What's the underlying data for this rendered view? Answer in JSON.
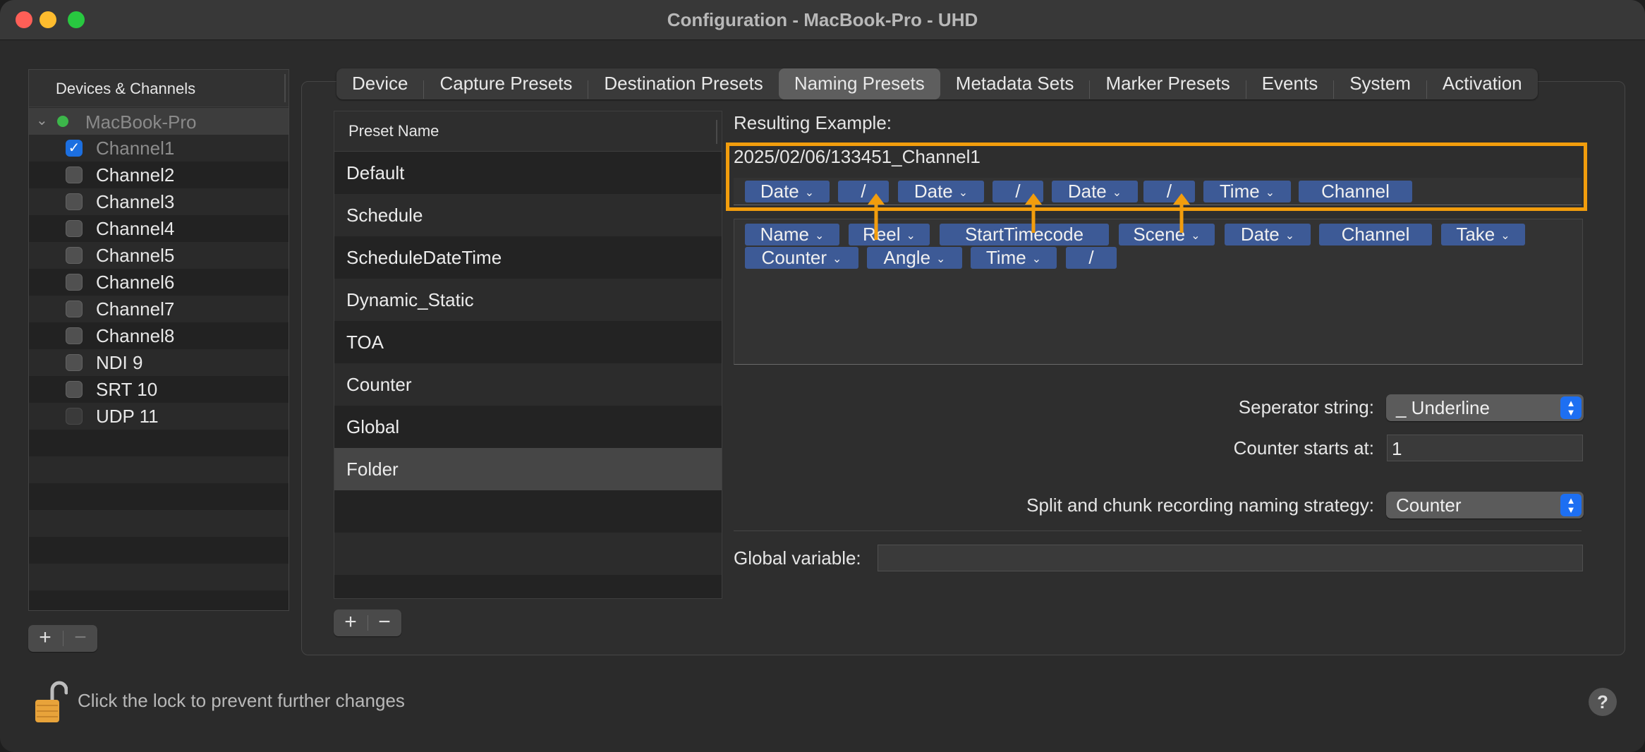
{
  "window": {
    "title": "Configuration - MacBook-Pro - UHD"
  },
  "devices": {
    "header": "Devices & Channels",
    "device": {
      "name": "MacBook-Pro",
      "status_color": "#3cb64a"
    },
    "channels": [
      {
        "label": "Channel1",
        "checked": true
      },
      {
        "label": "Channel2",
        "checked": false
      },
      {
        "label": "Channel3",
        "checked": false
      },
      {
        "label": "Channel4",
        "checked": false
      },
      {
        "label": "Channel5",
        "checked": false
      },
      {
        "label": "Channel6",
        "checked": false
      },
      {
        "label": "Channel7",
        "checked": false
      },
      {
        "label": "Channel8",
        "checked": false
      },
      {
        "label": "NDI 9",
        "checked": false
      },
      {
        "label": "SRT 10",
        "checked": false
      },
      {
        "label": "UDP 11",
        "checked": false
      }
    ],
    "add_label": "+",
    "remove_label": "−"
  },
  "tabs": [
    {
      "label": "Device",
      "active": false
    },
    {
      "label": "Capture Presets",
      "active": false
    },
    {
      "label": "Destination Presets",
      "active": false
    },
    {
      "label": "Naming Presets",
      "active": true
    },
    {
      "label": "Metadata Sets",
      "active": false
    },
    {
      "label": "Marker Presets",
      "active": false
    },
    {
      "label": "Events",
      "active": false
    },
    {
      "label": "System",
      "active": false
    },
    {
      "label": "Activation",
      "active": false
    }
  ],
  "presets": {
    "column_header": "Preset Name",
    "items": [
      "Default",
      "Schedule",
      "ScheduleDateTime",
      "Dynamic_Static",
      "TOA",
      "Counter",
      "Global",
      "Folder"
    ],
    "selected": "Folder",
    "add_label": "+",
    "remove_label": "−"
  },
  "naming": {
    "resulting_example_label": "Resulting Example:",
    "resulting_example_value": "2025/02/06/133451_Channel1",
    "pattern_tokens": [
      {
        "label": "Date",
        "dropdown": true
      },
      {
        "label": "/",
        "dropdown": false
      },
      {
        "label": "Date",
        "dropdown": true
      },
      {
        "label": "/",
        "dropdown": false
      },
      {
        "label": "Date",
        "dropdown": true
      },
      {
        "label": "/",
        "dropdown": false
      },
      {
        "label": "Time",
        "dropdown": true
      },
      {
        "label": "Channel",
        "dropdown": false
      }
    ],
    "available_tokens": [
      {
        "label": "Name",
        "dropdown": true
      },
      {
        "label": "Reel",
        "dropdown": true
      },
      {
        "label": "StartTimecode",
        "dropdown": false
      },
      {
        "label": "Scene",
        "dropdown": true
      },
      {
        "label": "Date",
        "dropdown": true
      },
      {
        "label": "Channel",
        "dropdown": false
      },
      {
        "label": "Take",
        "dropdown": true
      },
      {
        "label": "Counter",
        "dropdown": true
      },
      {
        "label": "Angle",
        "dropdown": true
      },
      {
        "label": "Time",
        "dropdown": true
      },
      {
        "label": "/",
        "dropdown": false
      }
    ],
    "separator_label": "Seperator string:",
    "separator_value": "_ Underline",
    "counter_label": "Counter starts at:",
    "counter_value": "1",
    "split_label": "Split and chunk recording naming strategy:",
    "split_value": "Counter",
    "global_label": "Global variable:",
    "global_value": "",
    "highlight_color": "#f29d0d",
    "token_color": "#3d5a96"
  },
  "footer": {
    "lock_text": "Click the lock to prevent further changes",
    "help_label": "?"
  }
}
